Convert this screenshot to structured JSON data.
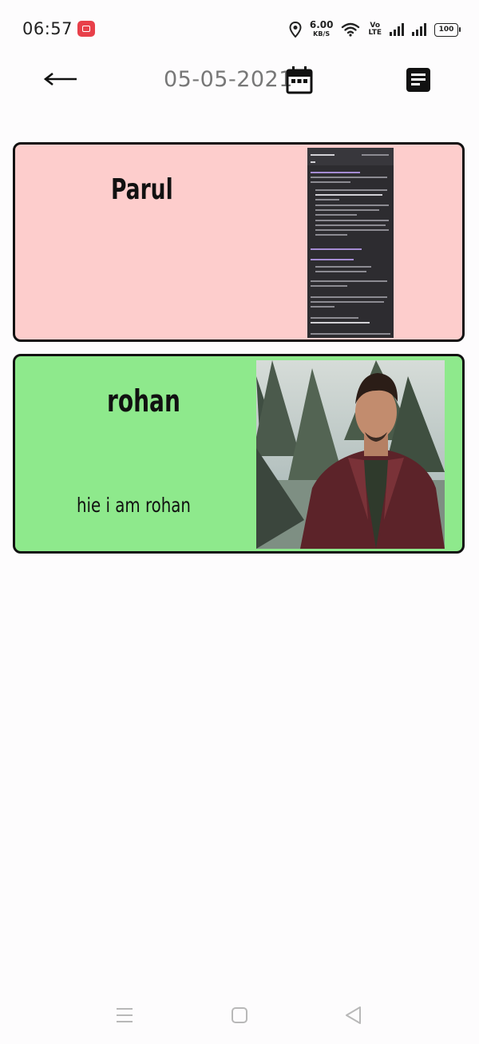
{
  "status_bar": {
    "time": "06:57",
    "net_speed_value": "6.00",
    "net_speed_unit": "KB/S",
    "volte_top": "Vo",
    "volte_bottom": "LTE",
    "battery": "100"
  },
  "app_bar": {
    "date": "05-05-2021"
  },
  "entries": [
    {
      "name": "Parul",
      "message": "",
      "background": "#fdcdcc"
    },
    {
      "name": "rohan",
      "message": "hie i am rohan",
      "background": "#8ee98c"
    }
  ]
}
